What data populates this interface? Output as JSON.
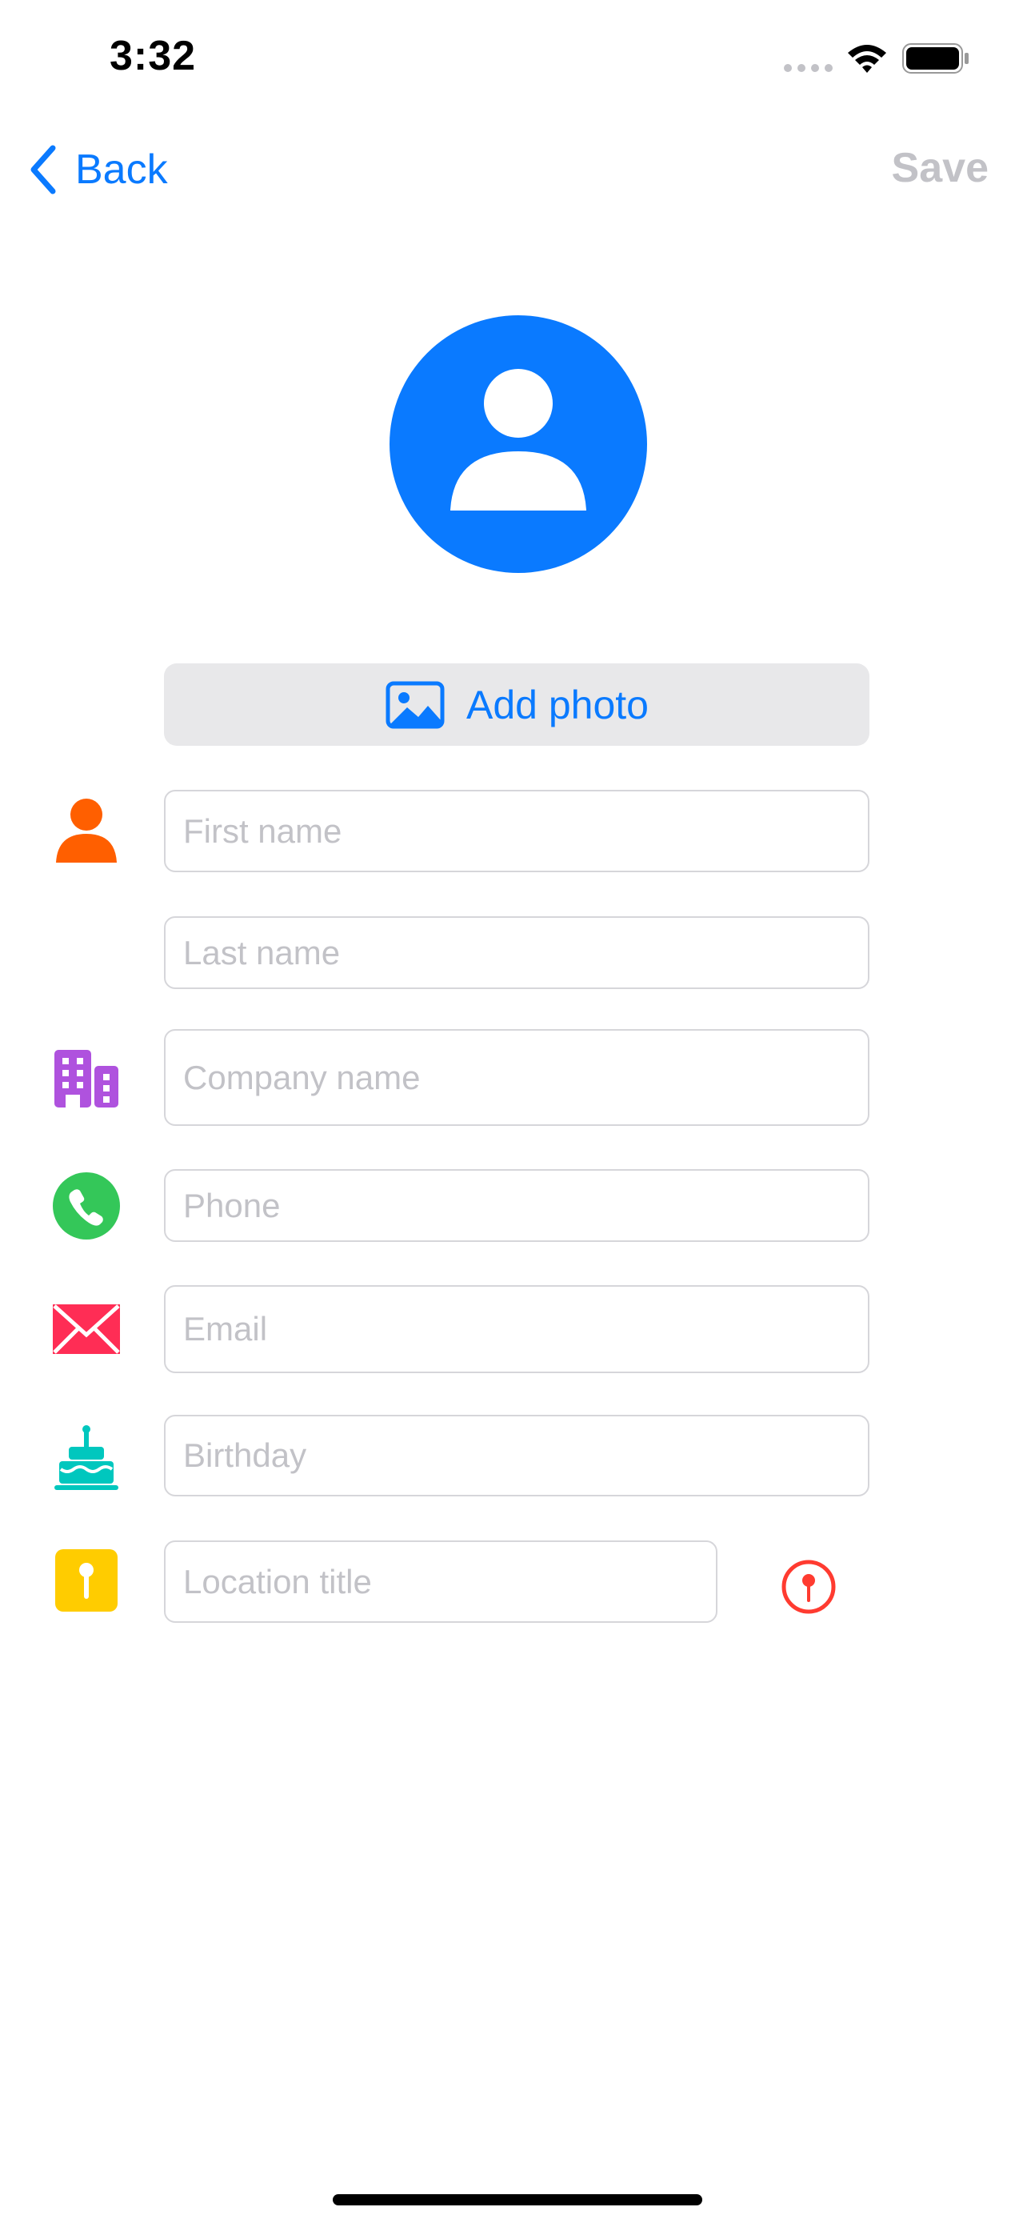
{
  "status_bar": {
    "time": "3:32"
  },
  "nav": {
    "back_label": "Back",
    "save_label": "Save"
  },
  "photo": {
    "add_photo_label": "Add photo"
  },
  "form": {
    "first_name": {
      "placeholder": "First name",
      "value": ""
    },
    "last_name": {
      "placeholder": "Last name",
      "value": ""
    },
    "company": {
      "placeholder": "Company name",
      "value": ""
    },
    "phone": {
      "placeholder": "Phone",
      "value": ""
    },
    "email": {
      "placeholder": "Email",
      "value": ""
    },
    "birthday": {
      "placeholder": "Birthday",
      "value": ""
    },
    "location": {
      "placeholder": "Location title",
      "value": ""
    }
  },
  "icons": {
    "back": "chevron-left-icon",
    "avatar": "person-silhouette-icon",
    "photo": "photo-icon",
    "person": "person-icon",
    "company": "building-icon",
    "phone": "phone-icon",
    "email": "envelope-icon",
    "birthday": "cake-icon",
    "location": "map-pin-icon",
    "pick_location": "pin-circle-icon"
  },
  "colors": {
    "accent": "#0a7aff",
    "save_disabled": "#c2c2c7",
    "person": "#ff5f00",
    "company": "#af52de",
    "phone": "#34c759",
    "email": "#ff2d55",
    "birthday": "#00c7be",
    "location": "#ffcc00",
    "pick_location": "#ff3b30"
  }
}
